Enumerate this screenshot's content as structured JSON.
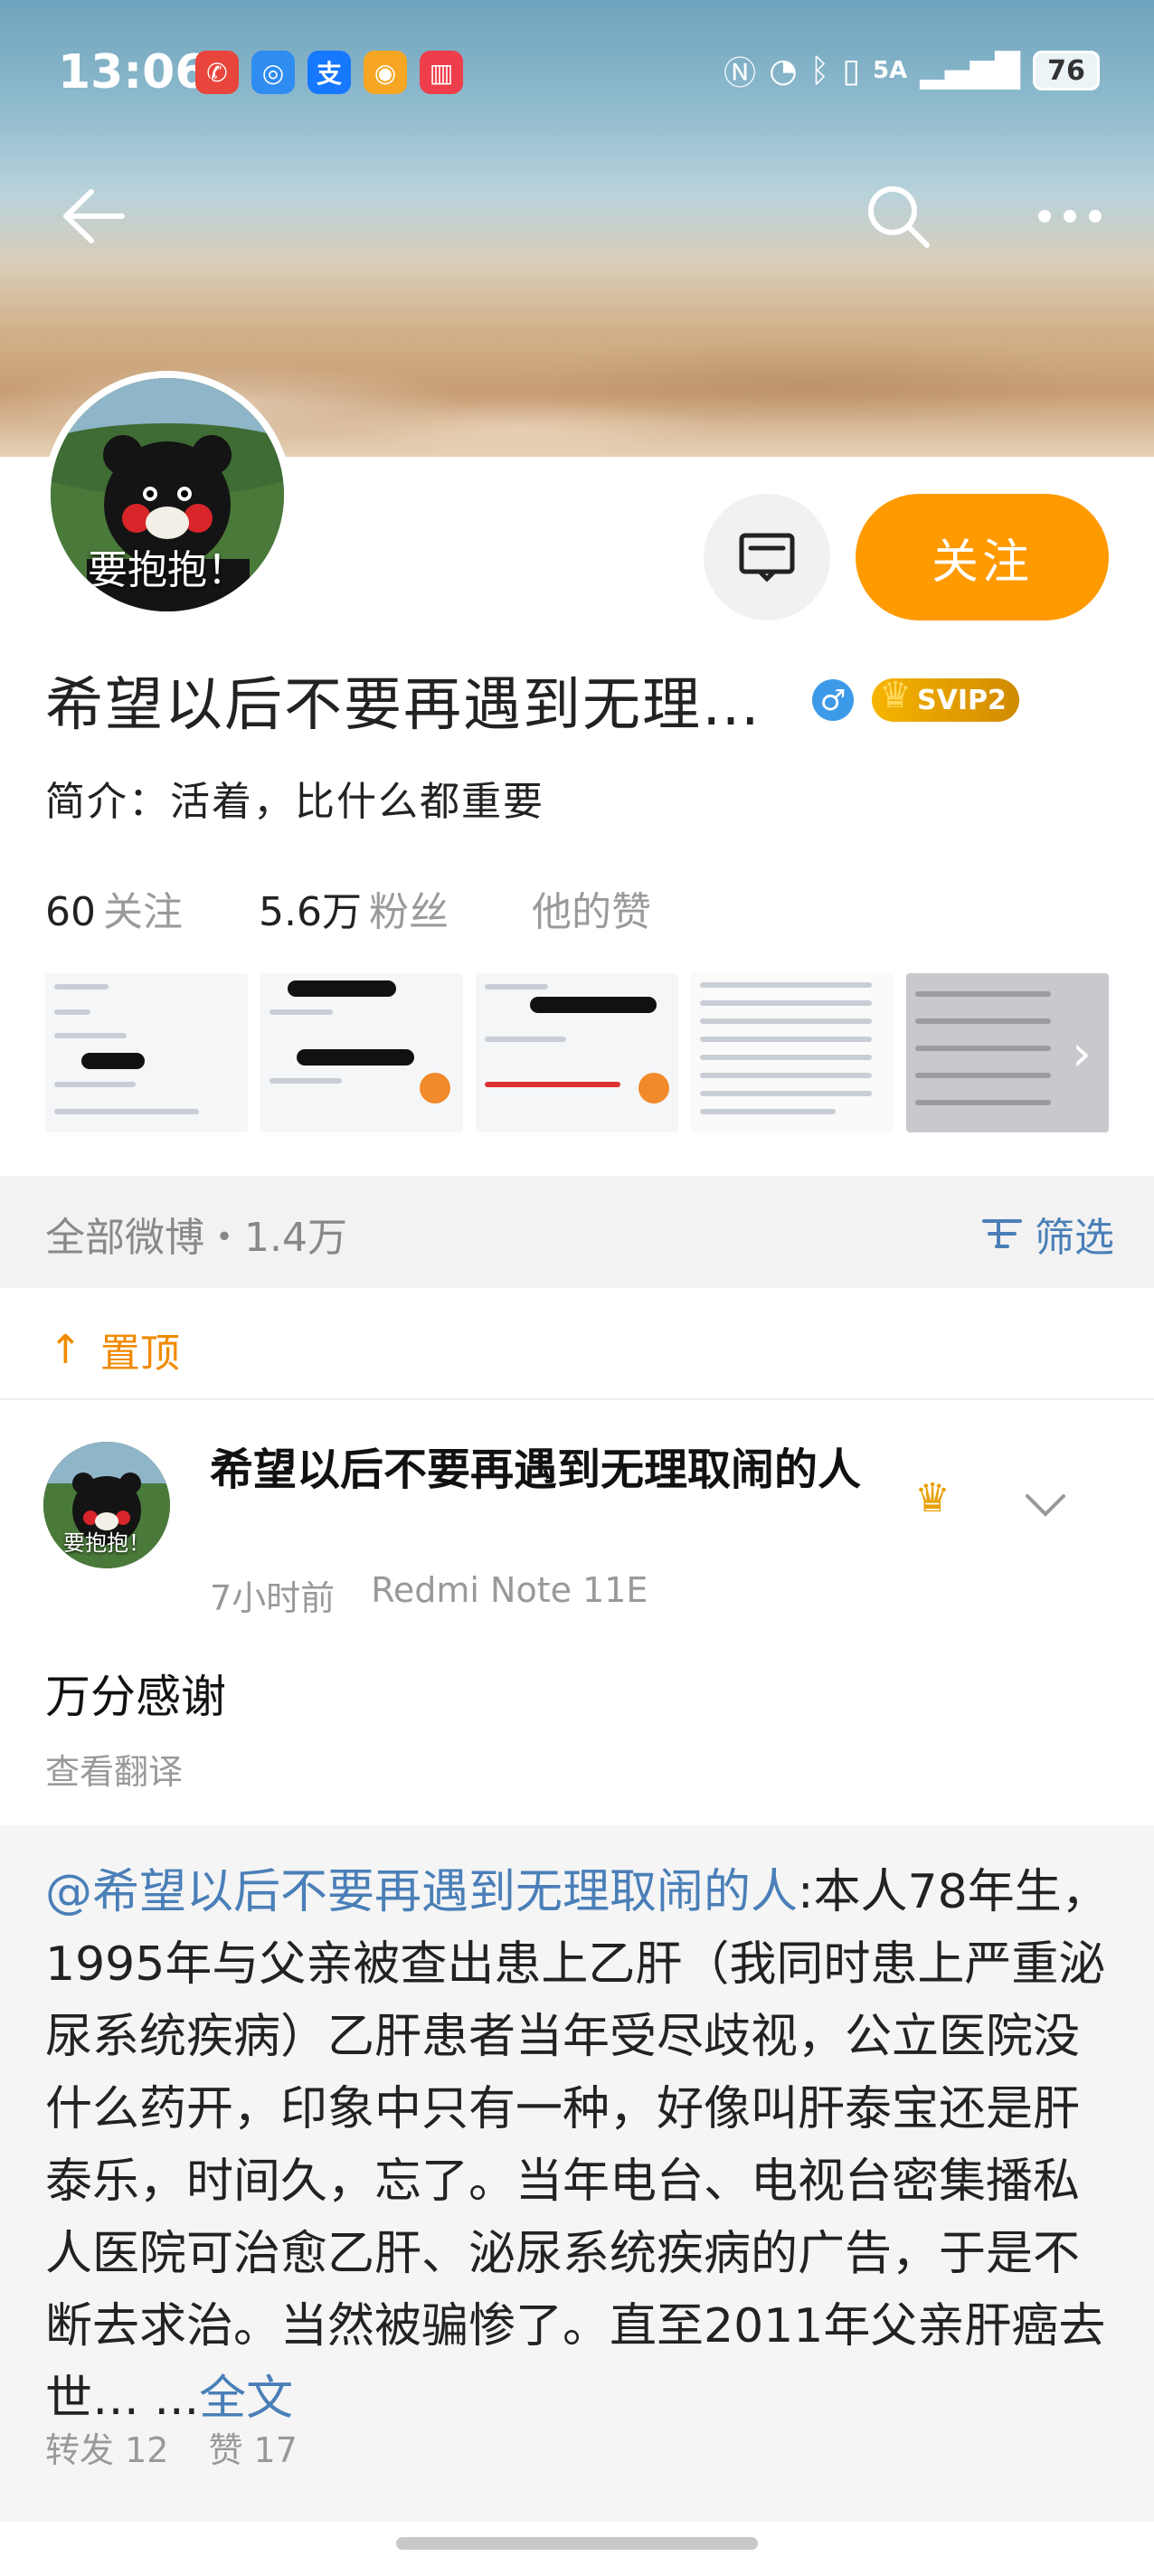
{
  "status_bar": {
    "time": "13:06",
    "network": "5A",
    "battery": "76"
  },
  "nav": {
    "back_icon": "back-arrow-icon",
    "search_icon": "search-icon",
    "more_icon": "more-icon"
  },
  "profile": {
    "avatar_caption": "要抱抱！",
    "name": "希望以后不要再遇到无理…",
    "gender_symbol": "♂",
    "vip_label": "SVIP2",
    "bio": "简介：活着，比什么都重要",
    "follow_label": "关注",
    "stats": [
      {
        "num": "60",
        "label": "关注"
      },
      {
        "num": "5.6万",
        "label": "粉丝"
      },
      {
        "num": "",
        "label": "他的赞"
      }
    ]
  },
  "tabs": {
    "all_weibo": "全部微博・1.4万",
    "filter_label": "筛选"
  },
  "pinned": {
    "label": "置顶"
  },
  "post": {
    "author": "希望以后不要再遇到无理取闹的人",
    "time": "7小时前",
    "device": "Redmi Note 11E",
    "text": "万分感谢",
    "translate": "查看翻译",
    "repost": {
      "mention": "@希望以后不要再遇到无理取闹的人",
      "body": ":本人78年生，1995年与父亲被查出患上乙肝（我同时患上严重泌尿系统疾病）乙肝患者当年受尽歧视，公立医院没什么药开，印象中只有一种，好像叫肝泰宝还是肝泰乐，时间久，忘了。当年电台、电视台密集播私人医院可治愈乙肝、泌尿系统疾病的广告，于是不断去求治。当然被骗惨了。直至2011年父亲肝癌去世…  ...",
      "fulltext": "全文",
      "forward": "转发 12",
      "likes": "赞 17"
    }
  },
  "colors": {
    "accent_orange": "#ff9a00",
    "link_blue": "#4a7fb8"
  }
}
